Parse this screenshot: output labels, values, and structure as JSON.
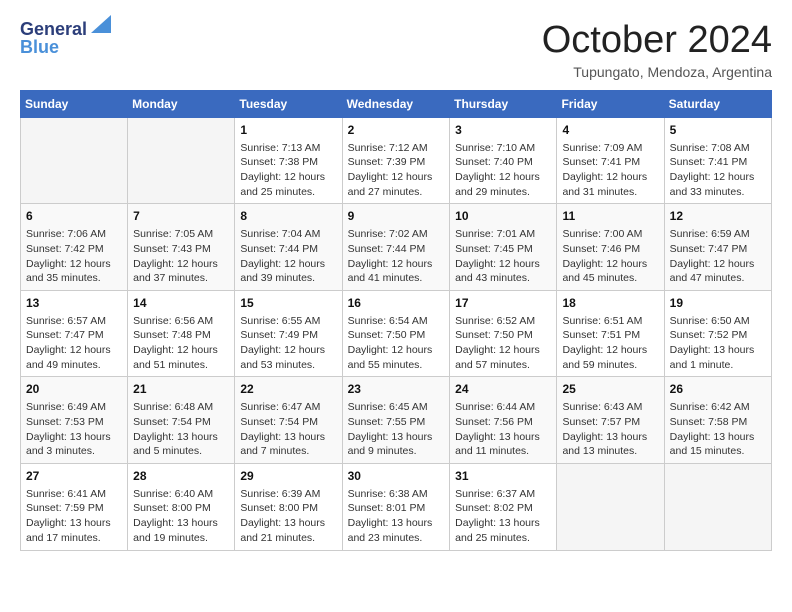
{
  "header": {
    "logo_line1": "General",
    "logo_line2": "Blue",
    "title": "October 2024",
    "subtitle": "Tupungato, Mendoza, Argentina"
  },
  "weekdays": [
    "Sunday",
    "Monday",
    "Tuesday",
    "Wednesday",
    "Thursday",
    "Friday",
    "Saturday"
  ],
  "weeks": [
    [
      {
        "day": "",
        "info": ""
      },
      {
        "day": "",
        "info": ""
      },
      {
        "day": "1",
        "info": "Sunrise: 7:13 AM\nSunset: 7:38 PM\nDaylight: 12 hours and 25 minutes."
      },
      {
        "day": "2",
        "info": "Sunrise: 7:12 AM\nSunset: 7:39 PM\nDaylight: 12 hours and 27 minutes."
      },
      {
        "day": "3",
        "info": "Sunrise: 7:10 AM\nSunset: 7:40 PM\nDaylight: 12 hours and 29 minutes."
      },
      {
        "day": "4",
        "info": "Sunrise: 7:09 AM\nSunset: 7:41 PM\nDaylight: 12 hours and 31 minutes."
      },
      {
        "day": "5",
        "info": "Sunrise: 7:08 AM\nSunset: 7:41 PM\nDaylight: 12 hours and 33 minutes."
      }
    ],
    [
      {
        "day": "6",
        "info": "Sunrise: 7:06 AM\nSunset: 7:42 PM\nDaylight: 12 hours and 35 minutes."
      },
      {
        "day": "7",
        "info": "Sunrise: 7:05 AM\nSunset: 7:43 PM\nDaylight: 12 hours and 37 minutes."
      },
      {
        "day": "8",
        "info": "Sunrise: 7:04 AM\nSunset: 7:44 PM\nDaylight: 12 hours and 39 minutes."
      },
      {
        "day": "9",
        "info": "Sunrise: 7:02 AM\nSunset: 7:44 PM\nDaylight: 12 hours and 41 minutes."
      },
      {
        "day": "10",
        "info": "Sunrise: 7:01 AM\nSunset: 7:45 PM\nDaylight: 12 hours and 43 minutes."
      },
      {
        "day": "11",
        "info": "Sunrise: 7:00 AM\nSunset: 7:46 PM\nDaylight: 12 hours and 45 minutes."
      },
      {
        "day": "12",
        "info": "Sunrise: 6:59 AM\nSunset: 7:47 PM\nDaylight: 12 hours and 47 minutes."
      }
    ],
    [
      {
        "day": "13",
        "info": "Sunrise: 6:57 AM\nSunset: 7:47 PM\nDaylight: 12 hours and 49 minutes."
      },
      {
        "day": "14",
        "info": "Sunrise: 6:56 AM\nSunset: 7:48 PM\nDaylight: 12 hours and 51 minutes."
      },
      {
        "day": "15",
        "info": "Sunrise: 6:55 AM\nSunset: 7:49 PM\nDaylight: 12 hours and 53 minutes."
      },
      {
        "day": "16",
        "info": "Sunrise: 6:54 AM\nSunset: 7:50 PM\nDaylight: 12 hours and 55 minutes."
      },
      {
        "day": "17",
        "info": "Sunrise: 6:52 AM\nSunset: 7:50 PM\nDaylight: 12 hours and 57 minutes."
      },
      {
        "day": "18",
        "info": "Sunrise: 6:51 AM\nSunset: 7:51 PM\nDaylight: 12 hours and 59 minutes."
      },
      {
        "day": "19",
        "info": "Sunrise: 6:50 AM\nSunset: 7:52 PM\nDaylight: 13 hours and 1 minute."
      }
    ],
    [
      {
        "day": "20",
        "info": "Sunrise: 6:49 AM\nSunset: 7:53 PM\nDaylight: 13 hours and 3 minutes."
      },
      {
        "day": "21",
        "info": "Sunrise: 6:48 AM\nSunset: 7:54 PM\nDaylight: 13 hours and 5 minutes."
      },
      {
        "day": "22",
        "info": "Sunrise: 6:47 AM\nSunset: 7:54 PM\nDaylight: 13 hours and 7 minutes."
      },
      {
        "day": "23",
        "info": "Sunrise: 6:45 AM\nSunset: 7:55 PM\nDaylight: 13 hours and 9 minutes."
      },
      {
        "day": "24",
        "info": "Sunrise: 6:44 AM\nSunset: 7:56 PM\nDaylight: 13 hours and 11 minutes."
      },
      {
        "day": "25",
        "info": "Sunrise: 6:43 AM\nSunset: 7:57 PM\nDaylight: 13 hours and 13 minutes."
      },
      {
        "day": "26",
        "info": "Sunrise: 6:42 AM\nSunset: 7:58 PM\nDaylight: 13 hours and 15 minutes."
      }
    ],
    [
      {
        "day": "27",
        "info": "Sunrise: 6:41 AM\nSunset: 7:59 PM\nDaylight: 13 hours and 17 minutes."
      },
      {
        "day": "28",
        "info": "Sunrise: 6:40 AM\nSunset: 8:00 PM\nDaylight: 13 hours and 19 minutes."
      },
      {
        "day": "29",
        "info": "Sunrise: 6:39 AM\nSunset: 8:00 PM\nDaylight: 13 hours and 21 minutes."
      },
      {
        "day": "30",
        "info": "Sunrise: 6:38 AM\nSunset: 8:01 PM\nDaylight: 13 hours and 23 minutes."
      },
      {
        "day": "31",
        "info": "Sunrise: 6:37 AM\nSunset: 8:02 PM\nDaylight: 13 hours and 25 minutes."
      },
      {
        "day": "",
        "info": ""
      },
      {
        "day": "",
        "info": ""
      }
    ]
  ]
}
